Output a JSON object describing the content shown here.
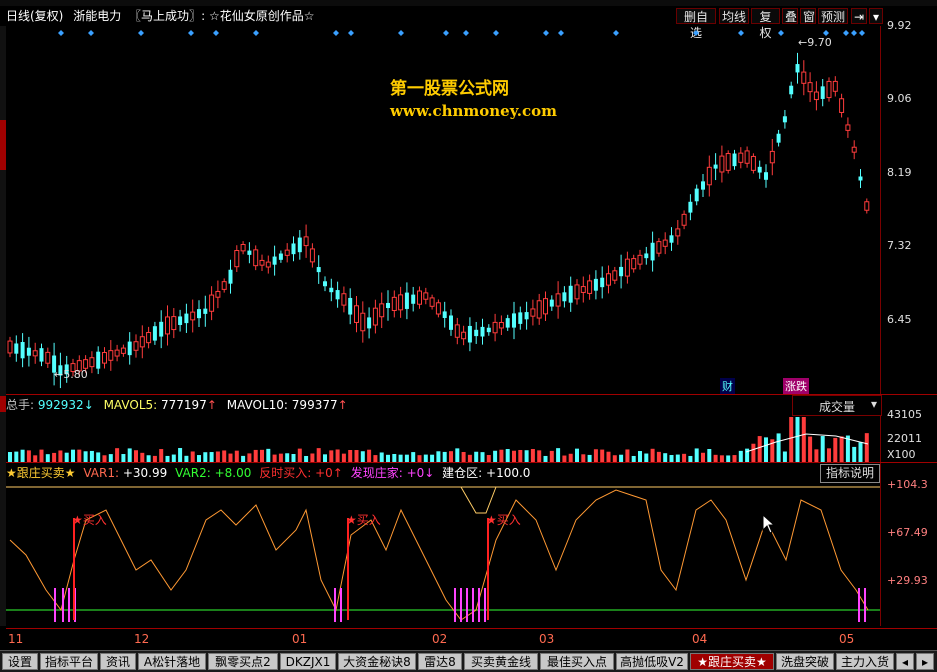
{
  "titlebar": {
    "period": "日线(复权)",
    "stock_name": "浙能电力",
    "formula": "〖马上成功〗",
    "author": "☆花仙女原创作品☆"
  },
  "toolbar": [
    "删自选",
    "均线",
    "复权",
    "叠",
    "窗",
    "预测"
  ],
  "watermark": {
    "line1": "第一股票公式网",
    "line2": "www.chnmoney.com"
  },
  "price_axis": {
    "labels": [
      "9.92",
      "9.06",
      "8.19",
      "7.32",
      "6.45"
    ]
  },
  "price_marks": {
    "high": "9.70",
    "low": "5.80"
  },
  "event_badges": [
    "财",
    "涨跌"
  ],
  "volume": {
    "total_label": "总手:",
    "total_value": "992932",
    "mavol5_label": "MAVOL5:",
    "mavol5_value": "777197",
    "mavol10_label": "MAVOL10:",
    "mavol10_value": "799377",
    "dropdown": "成交量",
    "axis": [
      "43105",
      "22011",
      "X100"
    ]
  },
  "indicator": {
    "name": "★跟庄买卖★",
    "var1_label": "VAR1:",
    "var1_value": "+30.99",
    "var2_label": "VAR2:",
    "var2_value": "+8.00",
    "fanbuy_label": "反时买入:",
    "fanbuy_value": "+0",
    "found_label": "发现庄家:",
    "found_value": "+0",
    "build_label": "建仓区:",
    "build_value": "+100.0",
    "help_button": "指标说明",
    "axis": [
      "+104.3",
      "+67.49",
      "+29.93"
    ],
    "buy_label": "★买入"
  },
  "dates": [
    "11",
    "12",
    "01",
    "02",
    "03",
    "04",
    "05"
  ],
  "tabs": [
    "设置",
    "指标平台",
    "资讯",
    "A松针落地",
    "飘零买点2",
    "DKZJX1",
    "大资金秘诀8",
    "雷达8",
    "买卖黄金线",
    "最佳买入点",
    "高抛低吸V2",
    "★跟庄买卖★",
    "洗盘突破",
    "主力入货"
  ],
  "colors": {
    "up": "#ff3c3c",
    "down": "#54ffff",
    "accent": "#a00000"
  }
}
